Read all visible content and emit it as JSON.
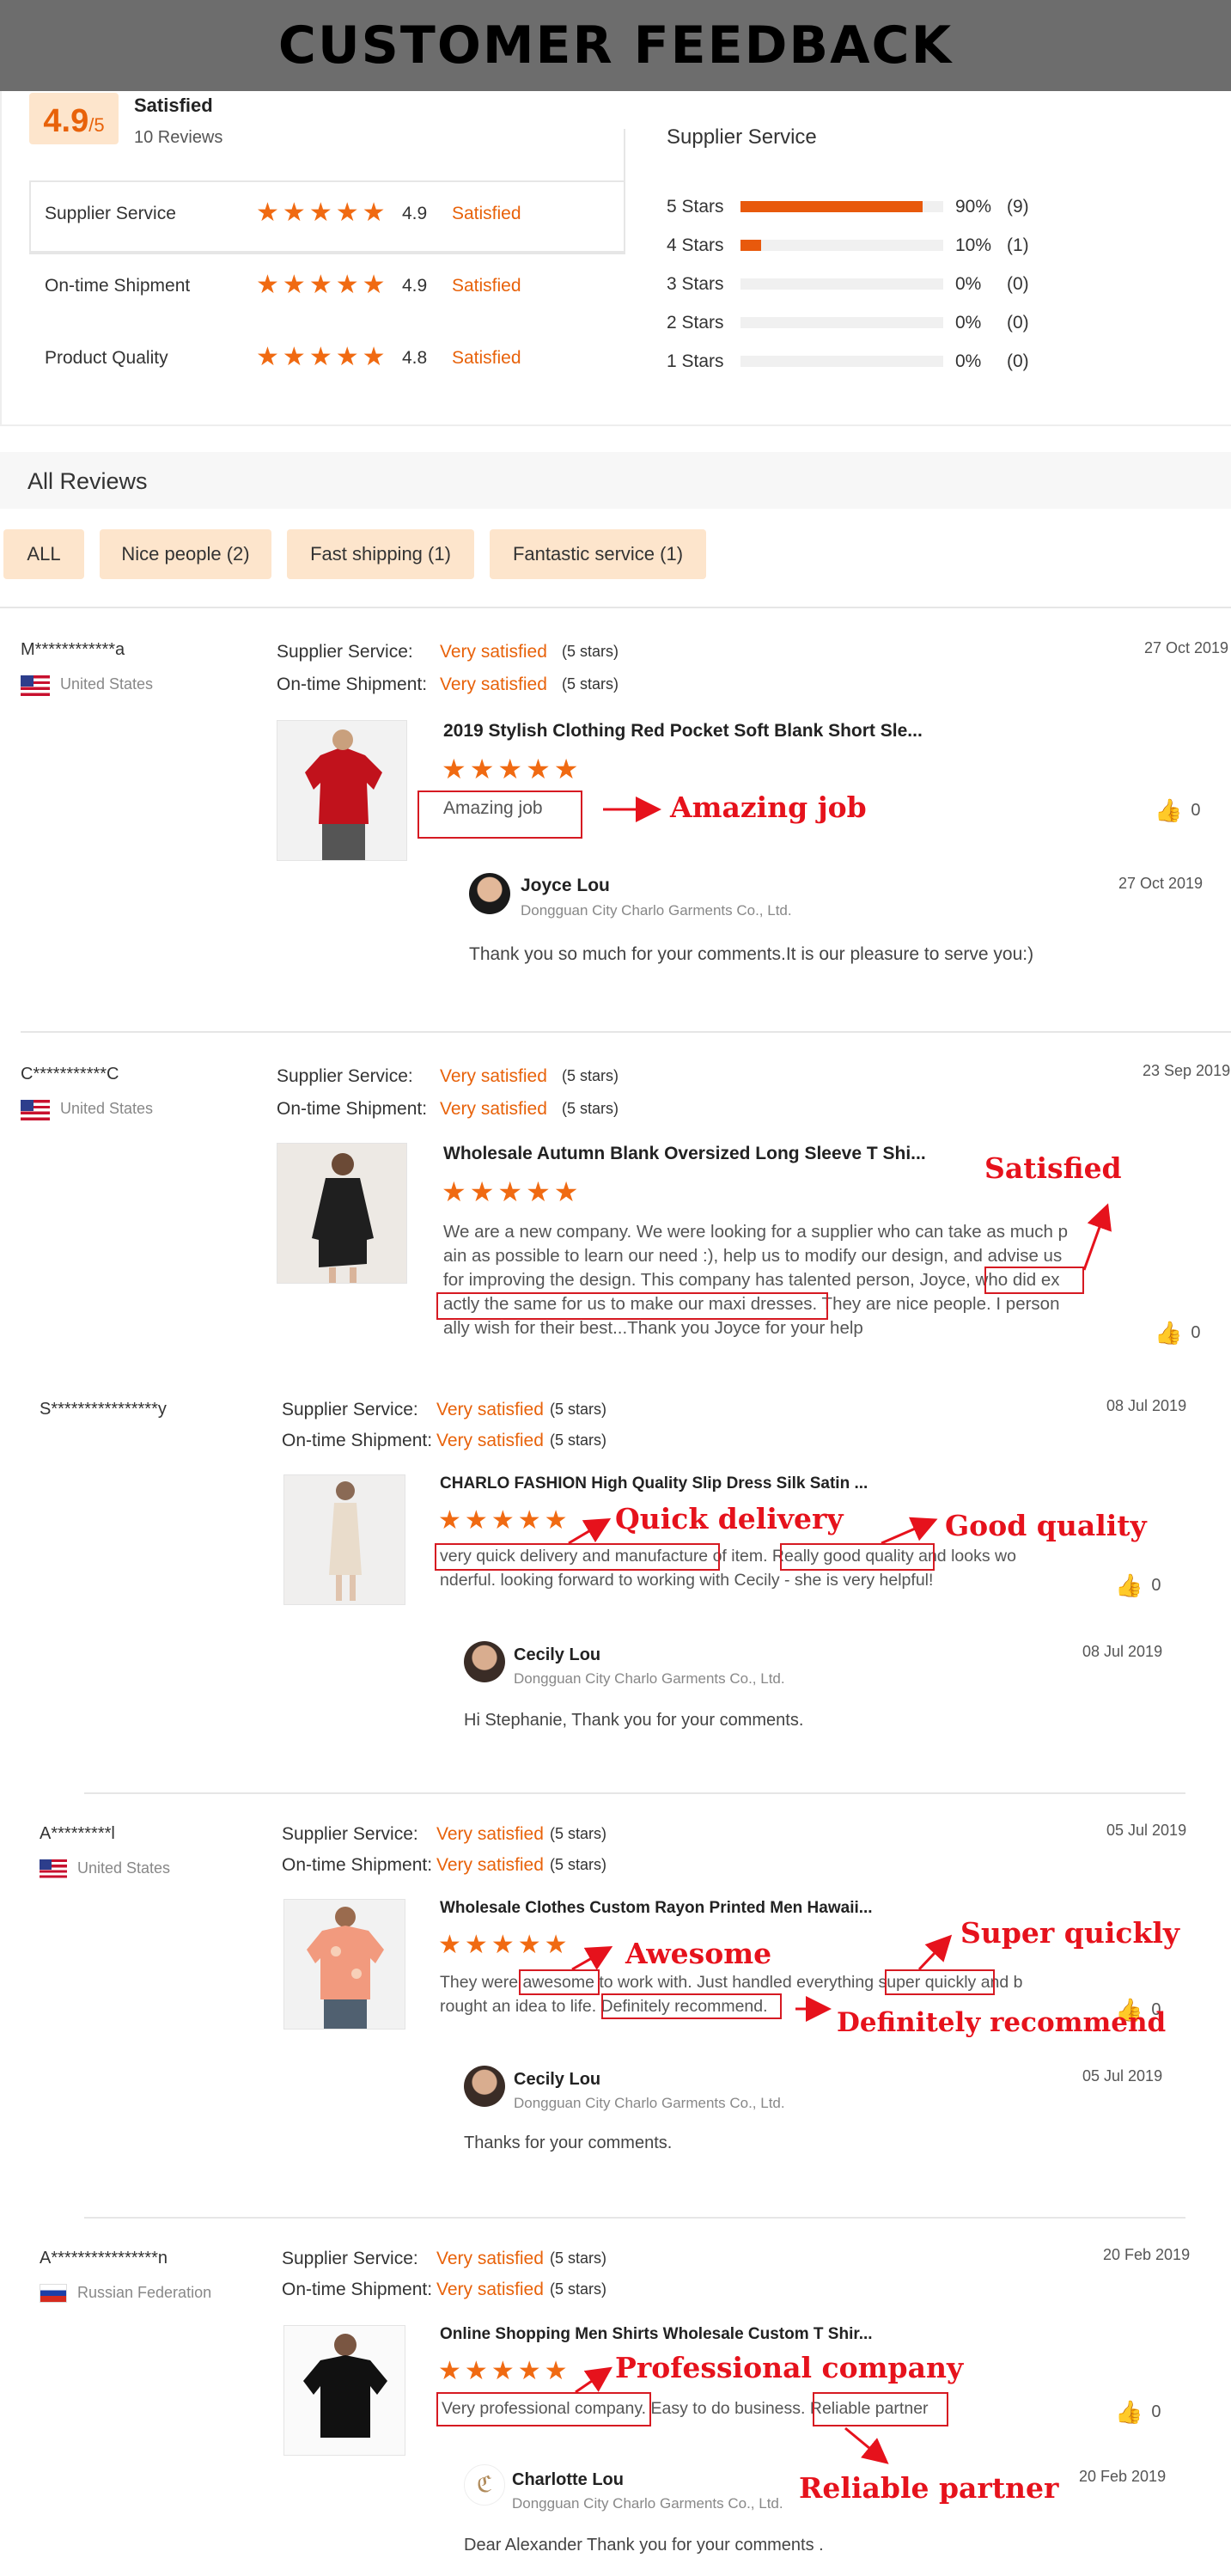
{
  "page": {
    "title": "CUSTOMER FEEDBACK"
  },
  "summary": {
    "score": "4.9",
    "score_suffix": "/5",
    "status": "Satisfied",
    "reviews_count": "10 Reviews",
    "metrics": [
      {
        "label": "Supplier Service",
        "score": "4.9",
        "status": "Satisfied"
      },
      {
        "label": "On-time Shipment",
        "score": "4.9",
        "status": "Satisfied"
      },
      {
        "label": "Product Quality",
        "score": "4.8",
        "status": "Satisfied"
      }
    ],
    "breakdown_title": "Supplier Service",
    "breakdown": [
      {
        "label": "5 Stars",
        "percent": "90%",
        "count": "(9)",
        "fraction": 0.9
      },
      {
        "label": "4 Stars",
        "percent": "10%",
        "count": "(1)",
        "fraction": 0.1
      },
      {
        "label": "3 Stars",
        "percent": "0%",
        "count": "(0)",
        "fraction": 0
      },
      {
        "label": "2 Stars",
        "percent": "0%",
        "count": "(0)",
        "fraction": 0
      },
      {
        "label": "1 Stars",
        "percent": "0%",
        "count": "(0)",
        "fraction": 0
      }
    ]
  },
  "all_reviews": {
    "title": "All Reviews",
    "filters": [
      "ALL",
      "Nice people (2)",
      "Fast shipping (1)",
      "Fantastic service (1)"
    ]
  },
  "labels": {
    "supplier_service": "Supplier Service:",
    "ontime_shipment": "On-time Shipment:",
    "very_satisfied": "Very satisfied",
    "five_stars": "(5 stars)"
  },
  "reviews": [
    {
      "user": "M************a",
      "country": "United States",
      "date": "27 Oct 2019",
      "product": "2019 Stylish Clothing Red Pocket Soft Blank Short Sle...",
      "text": "Amazing job",
      "likes": "0",
      "reply": {
        "name": "Joyce Lou",
        "company": "Dongguan City Charlo Garments Co., Ltd.",
        "date": "27 Oct 2019",
        "text": "Thank you so much for your comments.It is our pleasure to serve you:)"
      }
    },
    {
      "user": "C***********C",
      "country": "United States",
      "date": "23 Sep 2019",
      "product": "Wholesale Autumn Blank Oversized Long Sleeve T Shi...",
      "text_lines": [
        "We are a new company. We were looking for a supplier who can take as much p",
        "ain as possible to learn our need :), help us to modify our design, and advise us",
        "for improving the design. This company has talented person, Joyce, who did ex",
        "actly the same for us to make our maxi dresses. They are nice people. I person",
        "ally wish for their best...Thank you Joyce for your help"
      ],
      "likes": "0"
    },
    {
      "user": "S****************y",
      "date": "08 Jul 2019",
      "product": "CHARLO FASHION High Quality Slip Dress Silk Satin ...",
      "text_lines": [
        "very quick delivery and manufacture of item. Really good quality and looks wo",
        "nderful. looking forward to working with Cecily - she is very helpful!"
      ],
      "likes": "0",
      "reply": {
        "name": "Cecily Lou",
        "company": "Dongguan City Charlo Garments Co., Ltd.",
        "date": "08 Jul 2019",
        "text": "Hi Stephanie, Thank you for your comments."
      }
    },
    {
      "user": "A*********l",
      "country": "United States",
      "date": "05 Jul 2019",
      "product": "Wholesale Clothes Custom Rayon Printed Men Hawaii...",
      "text_lines": [
        "They were awesome to work with. Just handled everything super quickly and b",
        "rought an idea to life. Definitely recommend."
      ],
      "likes": "0",
      "reply": {
        "name": "Cecily Lou",
        "company": "Dongguan City Charlo Garments Co., Ltd.",
        "date": "05 Jul 2019",
        "text": "Thanks for your comments."
      }
    },
    {
      "user": "A****************n",
      "country": "Russian Federation",
      "date": "20 Feb 2019",
      "product": "Online Shopping Men Shirts Wholesale Custom T Shir...",
      "text": "Very professional company. Easy to do business. Reliable partner",
      "likes": "0",
      "reply": {
        "name": "Charlotte Lou",
        "company": "Dongguan City Charlo Garments Co., Ltd.",
        "date": "20 Feb 2019",
        "text": "Dear Alexander Thank you for your comments ."
      }
    }
  ],
  "annotations": {
    "amazing": "Amazing job",
    "satisfied": "Satisfied",
    "quick": "Quick delivery",
    "good": "Good quality",
    "awesome": "Awesome",
    "super": "Super quickly",
    "definitely": "Definitely recommend",
    "professional": "Professional company",
    "reliable": "Reliable partner"
  },
  "colors": {
    "accent": "#e8620a",
    "star": "#f06a12",
    "annotation": "#e6121c",
    "banner": "#6d6d6d"
  },
  "icons": {
    "star": "star-icon",
    "like": "thumbs-up-icon",
    "flag_us": "us-flag-icon",
    "flag_ru": "ru-flag-icon"
  }
}
